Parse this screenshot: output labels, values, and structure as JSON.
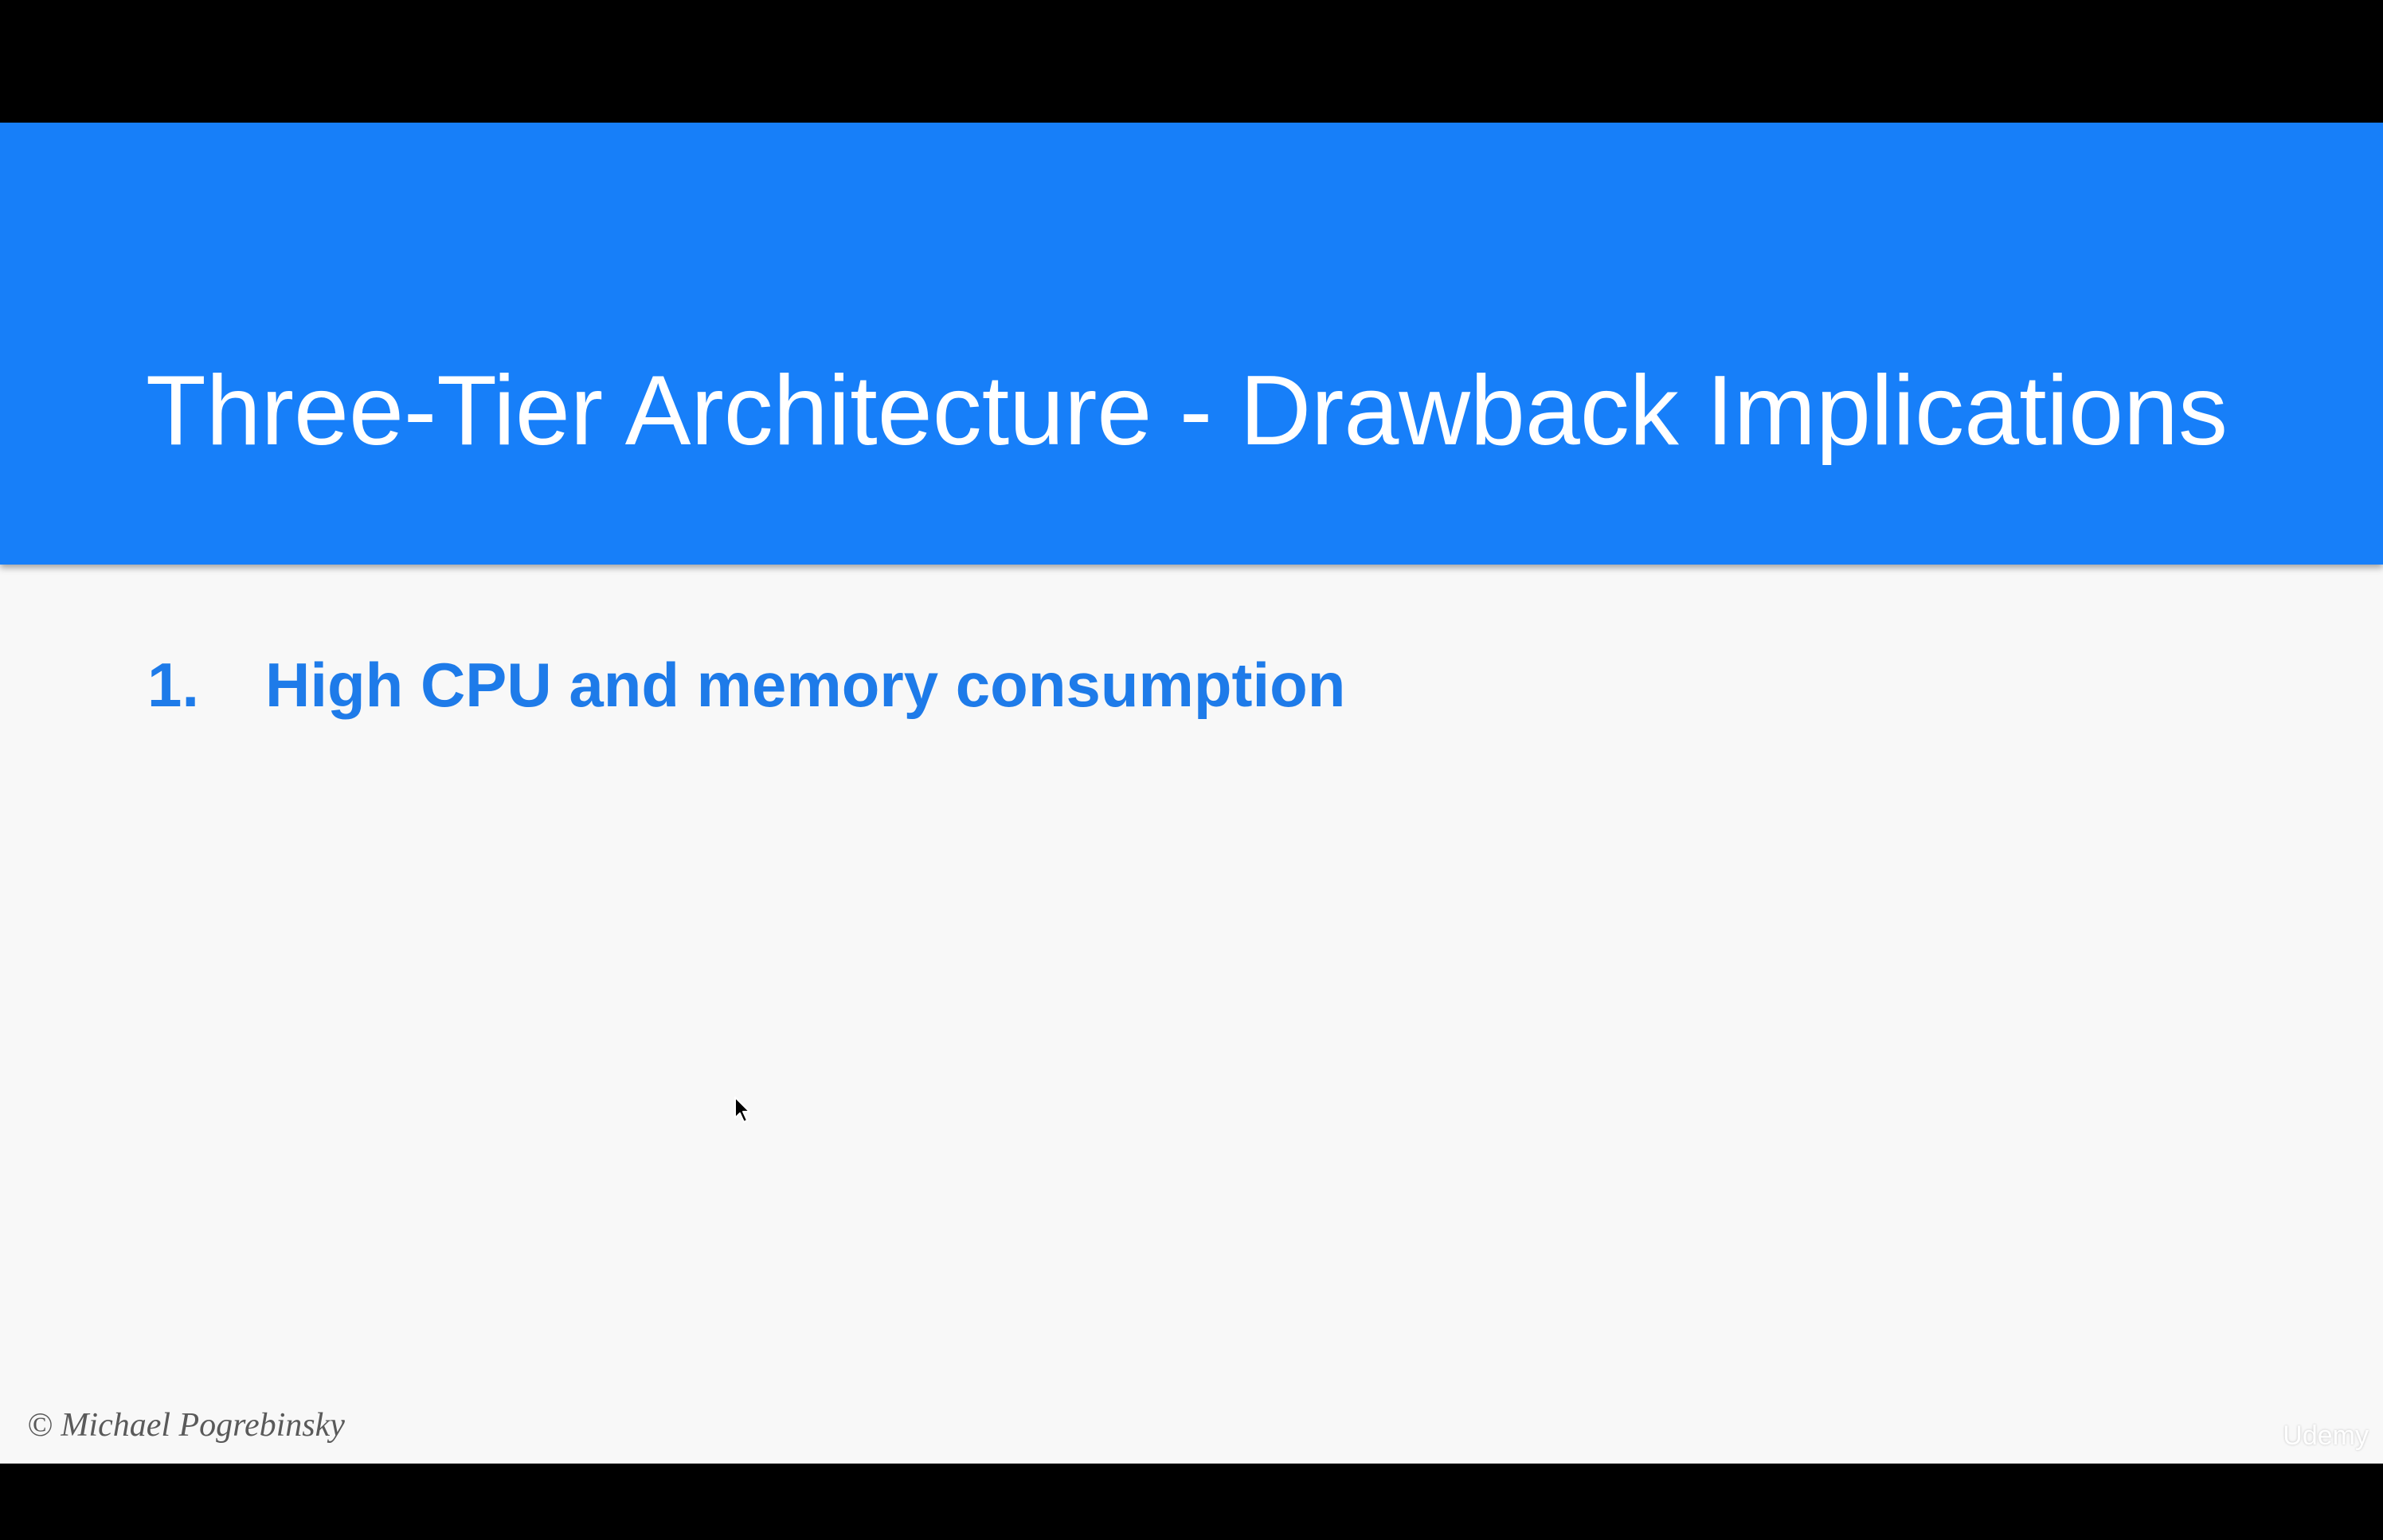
{
  "slide": {
    "title": "Three-Tier Architecture - Drawback Implications",
    "bullets": [
      {
        "number": "1.",
        "text": "High CPU and memory consumption"
      }
    ],
    "copyright": "© Michael Pogrebinsky",
    "watermark": "Udemy"
  },
  "colors": {
    "letterbox": "#000000",
    "header_background": "#177ff9",
    "title_text": "#ffffff",
    "slide_background": "#f8f8f8",
    "bullet_text": "#1e7be9"
  },
  "icons": {
    "cursor": "mouse-pointer-icon"
  }
}
